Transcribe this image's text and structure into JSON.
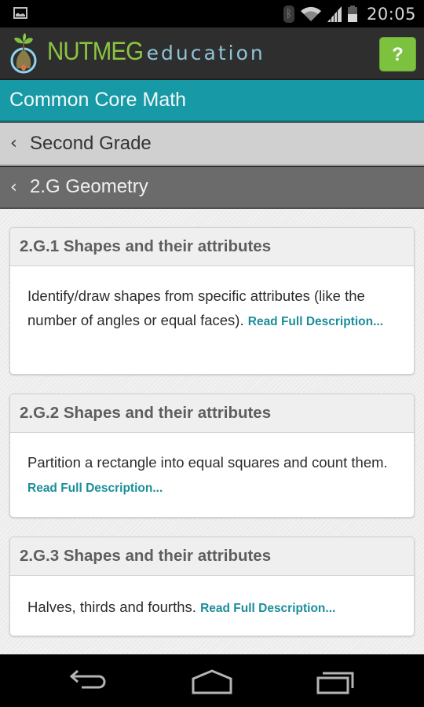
{
  "status_bar": {
    "notification_icon": "gallery-image-icon",
    "icons": [
      "bluetooth-icon",
      "wifi-icon",
      "cell-signal-icon",
      "battery-icon"
    ],
    "time": "20:05"
  },
  "app_header": {
    "logo_icon": "nutmeg-seedling-logo-icon",
    "brand_main": "NUTMEG",
    "brand_sub": "education",
    "help_button_label": "?"
  },
  "title_bar": {
    "title": "Common Core Math"
  },
  "breadcrumbs": [
    {
      "chevron": "‹",
      "label": "Second Grade"
    },
    {
      "chevron": "‹",
      "label": "2.G Geometry"
    }
  ],
  "standards": [
    {
      "title": "2.G.1 Shapes and their attributes",
      "description": "Identify/draw shapes from specific attributes (like the number of angles or equal faces).",
      "link": "Read Full Description..."
    },
    {
      "title": "2.G.2 Shapes and their attributes",
      "description": "Partition a rectangle into equal squares and count them.",
      "link": "Read Full Description..."
    },
    {
      "title": "2.G.3 Shapes and their attributes",
      "description": "Halves, thirds and fourths.",
      "link": "Read Full Description..."
    }
  ],
  "nav_bar": {
    "buttons": [
      "back-icon",
      "home-icon",
      "recent-apps-icon"
    ]
  },
  "colors": {
    "brand_green": "#8cc63f",
    "brand_blue": "#8fc3d6",
    "title_teal": "#1899a6",
    "link_teal": "#1a8e9a",
    "help_green": "#7cc23f"
  }
}
